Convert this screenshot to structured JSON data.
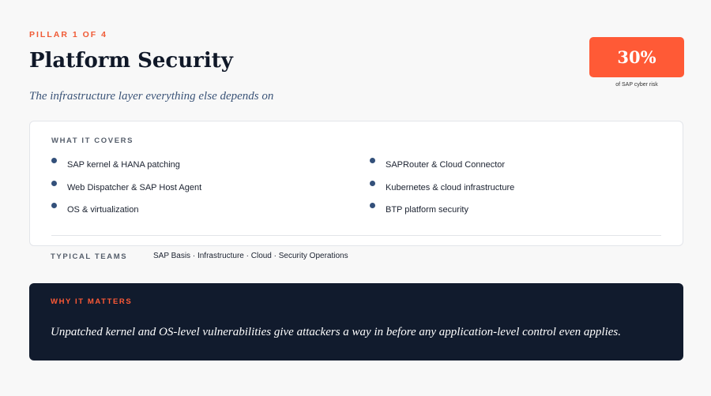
{
  "header": {
    "eyebrow": "PILLAR 1 OF 4",
    "title": "Platform Security",
    "subtitle": "The infrastructure layer everything else depends on"
  },
  "stat": {
    "value": "30%",
    "caption": "of SAP cyber risk",
    "color": "#ff5a36"
  },
  "covers": {
    "label": "WHAT IT COVERS",
    "left_items": [
      "SAP kernel & HANA patching",
      "Web Dispatcher & SAP Host Agent",
      "OS & virtualization"
    ],
    "right_items": [
      "SAPRouter & Cloud Connector",
      "Kubernetes & cloud infrastructure",
      "BTP platform security"
    ]
  },
  "teams": {
    "label": "TYPICAL TEAMS",
    "value": "SAP Basis · Infrastructure · Cloud · Security Operations"
  },
  "why": {
    "label": "WHY IT MATTERS",
    "text": "Unpatched kernel and OS-level vulnerabilities give attackers a way in before any application-level control even applies."
  },
  "colors": {
    "accent": "#f05a35",
    "navy": "#111b2d",
    "bullet": "#33507a"
  }
}
